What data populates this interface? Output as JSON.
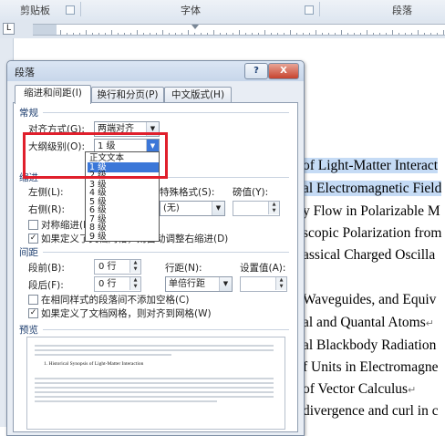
{
  "ribbon": {
    "groups": [
      "剪贴板",
      "字体",
      "段落"
    ]
  },
  "ruler": {
    "tab_selector": "L"
  },
  "document": {
    "lines": [
      {
        "text": "of Light-Matter Interact",
        "highlight": true
      },
      {
        "text": "al Electromagnetic Field",
        "highlight": true
      },
      {
        "text": "y Flow in Polarizable M",
        "highlight": false
      },
      {
        "text": "scopic Polarization from",
        "highlight": false
      },
      {
        "text": "assical Charged Oscilla",
        "highlight": false
      },
      {
        "text": "",
        "highlight": false
      },
      {
        "text": "Waveguides, and Equiv",
        "highlight": false
      },
      {
        "text": "al and Quantal Atoms",
        "highlight": false,
        "mark": "↵"
      },
      {
        "text": "al Blackbody Radiation",
        "highlight": false
      },
      {
        "text": "f Units in Electromagne",
        "highlight": false
      },
      {
        "text": "of Vector Calculus",
        "highlight": false,
        "mark": "↵"
      },
      {
        "text": "divergence and curl in c",
        "highlight": false
      }
    ]
  },
  "dialog": {
    "title": "段落",
    "help_label": "?",
    "close_label": "X",
    "tabs": [
      "缩进和间距(I)",
      "换行和分页(P)",
      "中文版式(H)"
    ],
    "general": {
      "section": "常规",
      "alignment_label": "对齐方式(G):",
      "alignment_value": "两端对齐",
      "outline_label": "大纲级别(O):",
      "outline_value": "1 级"
    },
    "outline_options": [
      "正文文本",
      "1 级",
      "2 级",
      "3 级",
      "4 级",
      "5 级",
      "6 级",
      "7 级",
      "8 级",
      "9 级"
    ],
    "indent": {
      "section": "缩进",
      "left_label": "左侧(L):",
      "right_label": "右侧(R):",
      "special_label": "特殊格式(S):",
      "special_value": "(无)",
      "by_label": "磅值(Y):",
      "mirror_label": "对称缩进(M)",
      "grid_label": "如果定义了文档网格，则自动调整右缩进(D)"
    },
    "spacing": {
      "section": "间距",
      "before_label": "段前(B):",
      "before_value": "0 行",
      "after_label": "段后(F):",
      "after_value": "0 行",
      "line_label": "行距(N):",
      "line_value": "单倍行距",
      "at_label": "设置值(A):",
      "no_space_label": "在相同样式的段落间不添加空格(C)",
      "snap_label": "如果定义了文档网格，则对齐到网格(W)"
    },
    "preview": {
      "section": "预览",
      "sample": "1. Historical Synopsis of Light-Matter Interaction"
    }
  }
}
